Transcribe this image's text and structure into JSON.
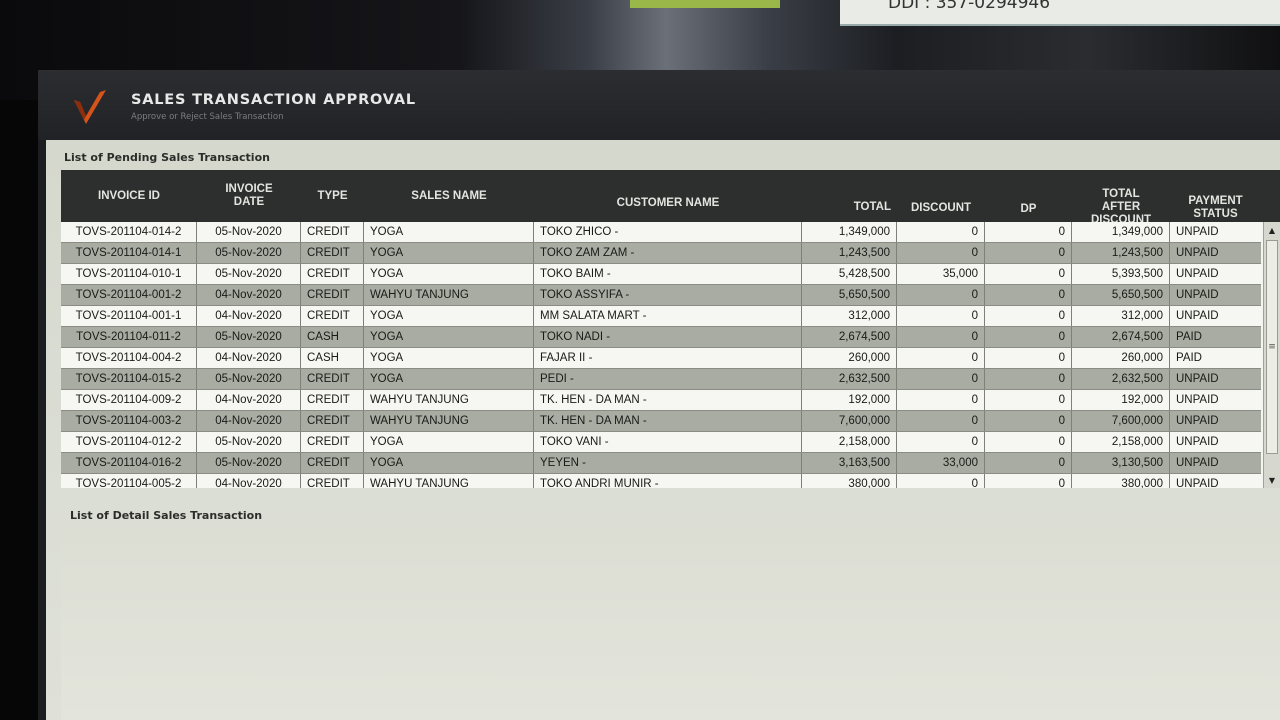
{
  "background": {
    "paper_text": "DDI : 357-0294946"
  },
  "app": {
    "title": "SALES TRANSACTION APPROVAL",
    "subtitle": "Approve or Reject Sales Transaction",
    "logo_icon": "v-logo-icon",
    "accent_color": "#d4541c"
  },
  "pending": {
    "label": "List of Pending Sales Transaction",
    "columns": {
      "invoice_id": "INVOICE ID",
      "invoice_date": "INVOICE DATE",
      "type": "TYPE",
      "sales_name": "SALES NAME",
      "customer_name": "CUSTOMER NAME",
      "total": "TOTAL",
      "discount": "DISCOUNT",
      "dp": "DP",
      "total_after_discount": "TOTAL AFTER DISCOUNT",
      "payment_status": "PAYMENT STATUS"
    },
    "rows": [
      {
        "invoice_id": "TOVS-201104-014-2",
        "date": "05-Nov-2020",
        "type": "CREDIT",
        "sales": "YOGA",
        "customer": "TOKO ZHICO -",
        "total": "1,349,000",
        "discount": "0",
        "dp": "0",
        "after": "1,349,000",
        "status": "UNPAID"
      },
      {
        "invoice_id": "TOVS-201104-014-1",
        "date": "05-Nov-2020",
        "type": "CREDIT",
        "sales": "YOGA",
        "customer": "TOKO ZAM ZAM -",
        "total": "1,243,500",
        "discount": "0",
        "dp": "0",
        "after": "1,243,500",
        "status": "UNPAID"
      },
      {
        "invoice_id": "TOVS-201104-010-1",
        "date": "05-Nov-2020",
        "type": "CREDIT",
        "sales": "YOGA",
        "customer": "TOKO BAIM -",
        "total": "5,428,500",
        "discount": "35,000",
        "dp": "0",
        "after": "5,393,500",
        "status": "UNPAID"
      },
      {
        "invoice_id": "TOVS-201104-001-2",
        "date": "04-Nov-2020",
        "type": "CREDIT",
        "sales": "WAHYU TANJUNG",
        "customer": "TOKO ASSYIFA -",
        "total": "5,650,500",
        "discount": "0",
        "dp": "0",
        "after": "5,650,500",
        "status": "UNPAID"
      },
      {
        "invoice_id": "TOVS-201104-001-1",
        "date": "04-Nov-2020",
        "type": "CREDIT",
        "sales": "YOGA",
        "customer": "MM SALATA MART -",
        "total": "312,000",
        "discount": "0",
        "dp": "0",
        "after": "312,000",
        "status": "UNPAID"
      },
      {
        "invoice_id": "TOVS-201104-011-2",
        "date": "05-Nov-2020",
        "type": "CASH",
        "sales": "YOGA",
        "customer": "TOKO NADI -",
        "total": "2,674,500",
        "discount": "0",
        "dp": "0",
        "after": "2,674,500",
        "status": "PAID"
      },
      {
        "invoice_id": "TOVS-201104-004-2",
        "date": "04-Nov-2020",
        "type": "CASH",
        "sales": "YOGA",
        "customer": "FAJAR II -",
        "total": "260,000",
        "discount": "0",
        "dp": "0",
        "after": "260,000",
        "status": "PAID"
      },
      {
        "invoice_id": "TOVS-201104-015-2",
        "date": "05-Nov-2020",
        "type": "CREDIT",
        "sales": "YOGA",
        "customer": "PEDI -",
        "total": "2,632,500",
        "discount": "0",
        "dp": "0",
        "after": "2,632,500",
        "status": "UNPAID"
      },
      {
        "invoice_id": "TOVS-201104-009-2",
        "date": "04-Nov-2020",
        "type": "CREDIT",
        "sales": "WAHYU TANJUNG",
        "customer": "TK. HEN - DA MAN -",
        "total": "192,000",
        "discount": "0",
        "dp": "0",
        "after": "192,000",
        "status": "UNPAID"
      },
      {
        "invoice_id": "TOVS-201104-003-2",
        "date": "04-Nov-2020",
        "type": "CREDIT",
        "sales": "WAHYU TANJUNG",
        "customer": "TK. HEN - DA MAN -",
        "total": "7,600,000",
        "discount": "0",
        "dp": "0",
        "after": "7,600,000",
        "status": "UNPAID"
      },
      {
        "invoice_id": "TOVS-201104-012-2",
        "date": "05-Nov-2020",
        "type": "CREDIT",
        "sales": "YOGA",
        "customer": "TOKO VANI -",
        "total": "2,158,000",
        "discount": "0",
        "dp": "0",
        "after": "2,158,000",
        "status": "UNPAID"
      },
      {
        "invoice_id": "TOVS-201104-016-2",
        "date": "05-Nov-2020",
        "type": "CREDIT",
        "sales": "YOGA",
        "customer": "YEYEN -",
        "total": "3,163,500",
        "discount": "33,000",
        "dp": "0",
        "after": "3,130,500",
        "status": "UNPAID"
      },
      {
        "invoice_id": "TOVS-201104-005-2",
        "date": "04-Nov-2020",
        "type": "CREDIT",
        "sales": "WAHYU TANJUNG",
        "customer": "TOKO ANDRI MUNIR -",
        "total": "380,000",
        "discount": "0",
        "dp": "0",
        "after": "380,000",
        "status": "UNPAID"
      }
    ],
    "scroll_icons": {
      "up": "scroll-up-arrow-icon",
      "down": "scroll-down-arrow-icon",
      "grip": "scroll-grip-icon"
    }
  },
  "detail": {
    "label": "List of Detail Sales Transaction"
  }
}
